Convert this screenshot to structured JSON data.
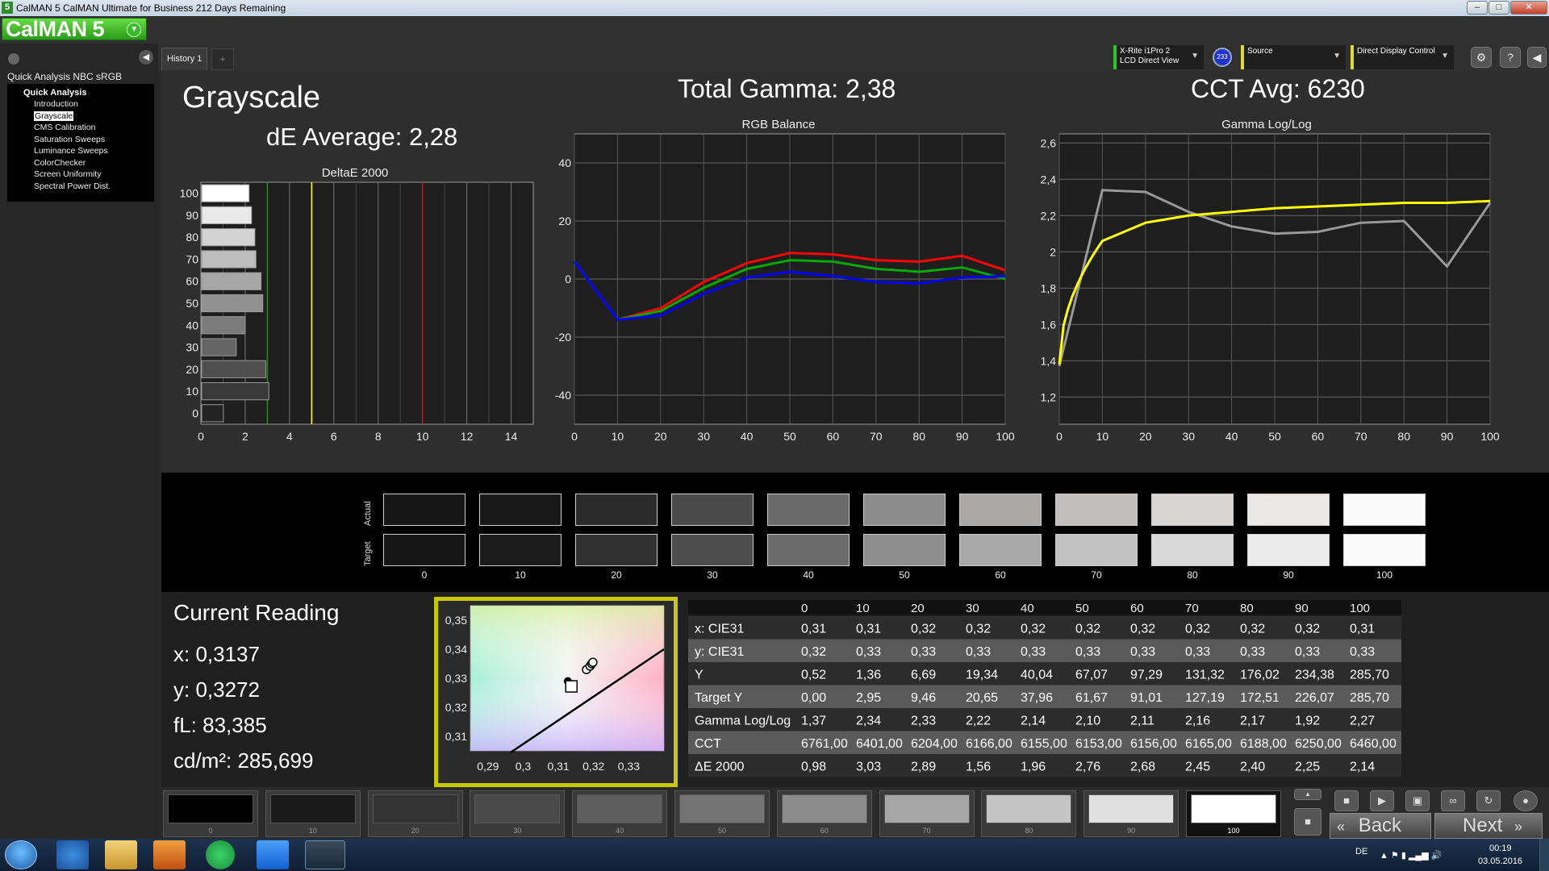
{
  "window": {
    "title": "CalMAN 5 CalMAN Ultimate for Business 212 Days Remaining",
    "app_icon": "5",
    "controls": [
      "–",
      "□",
      "✕"
    ]
  },
  "logo": {
    "text": "CalMAN 5"
  },
  "nav": {
    "title": "Quick Analysis NBC sRGB",
    "group": "Quick Analysis",
    "items": [
      "Introduction",
      "Grayscale",
      "CMS Calibration",
      "Saturation Sweeps",
      "Luminance Sweeps",
      "ColorChecker",
      "Screen Uniformity",
      "Spectral Power Dist."
    ],
    "selected": "Grayscale"
  },
  "tabs": [
    {
      "label": "History 1"
    }
  ],
  "devices": {
    "meter_line1": "X-Rite i1Pro 2",
    "meter_line2": "LCD Direct View",
    "meter_badge": "233",
    "source": "Source",
    "display": "Direct Display Control"
  },
  "toolbar_icons": [
    "gear-icon",
    "help-icon",
    "chevron-left-icon"
  ],
  "headings": {
    "section": "Grayscale",
    "de_average": "dE Average: 2,28",
    "total_gamma": "Total Gamma: 2,38",
    "cct_avg": "CCT Avg: 6230"
  },
  "chart_data": [
    {
      "type": "bar",
      "title": "DeltaE 2000",
      "orientation": "horizontal",
      "categories": [
        "100",
        "90",
        "80",
        "70",
        "60",
        "50",
        "40",
        "30",
        "20",
        "10",
        "0"
      ],
      "values": [
        2.14,
        2.25,
        2.4,
        2.45,
        2.68,
        2.76,
        1.96,
        1.56,
        2.89,
        3.03,
        0.98
      ],
      "xlim": [
        0,
        15
      ],
      "xticks": [
        "0",
        "2",
        "4",
        "6",
        "8",
        "10",
        "12",
        "14"
      ],
      "thresholds": [
        {
          "value": 3,
          "color": "#00aa00"
        },
        {
          "value": 5,
          "color": "#ffff00"
        },
        {
          "value": 10,
          "color": "#ff0000"
        }
      ]
    },
    {
      "type": "line",
      "title": "RGB Balance",
      "x": [
        0,
        10,
        20,
        30,
        40,
        50,
        60,
        70,
        80,
        90,
        100
      ],
      "ylim": [
        -50,
        50
      ],
      "yticks": [
        "40",
        "20",
        "0",
        "-20",
        "-40"
      ],
      "xticks": [
        "0",
        "10",
        "20",
        "30",
        "40",
        "50",
        "60",
        "70",
        "80",
        "90",
        "100"
      ],
      "series": [
        {
          "color": "#ff0000",
          "values": [
            6,
            -14,
            -10,
            -1,
            5.5,
            9,
            8.5,
            6.5,
            6,
            8,
            3
          ]
        },
        {
          "color": "#00aa00",
          "values": [
            6,
            -14,
            -11,
            -3,
            3.5,
            6.5,
            6,
            3.5,
            2.5,
            4,
            0
          ]
        },
        {
          "color": "#0000ff",
          "values": [
            6,
            -14,
            -12.5,
            -5,
            0.5,
            2.5,
            1,
            -1,
            -1.5,
            0.5,
            1
          ]
        }
      ]
    },
    {
      "type": "line",
      "title": "Gamma Log/Log",
      "x": [
        0,
        10,
        20,
        30,
        40,
        50,
        60,
        70,
        80,
        90,
        100
      ],
      "ylim": [
        1.05,
        2.65
      ],
      "yticks": [
        "2,6",
        "2,4",
        "2,2",
        "2",
        "1,8",
        "1,6",
        "1,4",
        "1,2"
      ],
      "xticks": [
        "0",
        "10",
        "20",
        "30",
        "40",
        "50",
        "60",
        "70",
        "80",
        "90",
        "100"
      ],
      "series": [
        {
          "color": "#999999",
          "values": [
            1.37,
            2.34,
            2.33,
            2.22,
            2.14,
            2.1,
            2.11,
            2.16,
            2.17,
            1.92,
            2.27
          ]
        },
        {
          "color": "#ffff00",
          "curve": "target",
          "values": [
            1.38,
            2.06,
            2.16,
            2.2,
            2.22,
            2.24,
            2.25,
            2.26,
            2.27,
            2.27,
            2.28
          ]
        }
      ]
    },
    {
      "type": "scatter",
      "title": "CIE xy",
      "xlim": [
        0.285,
        0.34
      ],
      "ylim": [
        0.305,
        0.355
      ],
      "xticks": [
        "0,29",
        "0,3",
        "0,31",
        "0,32",
        "0,33"
      ],
      "yticks": [
        "0,35",
        "0,34",
        "0,33",
        "0,32",
        "0,31"
      ],
      "target_point": [
        0.3127,
        0.329
      ],
      "measured": [
        [
          0.3137,
          0.3272
        ],
        [
          0.318,
          0.333
        ],
        [
          0.319,
          0.3342
        ],
        [
          0.3195,
          0.335
        ],
        [
          0.3198,
          0.3355
        ]
      ]
    }
  ],
  "swatches": {
    "labels": [
      "0",
      "10",
      "20",
      "30",
      "40",
      "50",
      "60",
      "70",
      "80",
      "90",
      "100"
    ],
    "row_actual": "Actual",
    "row_target": "Target",
    "actual_colors": [
      "#151515",
      "#191919",
      "#2b2b2b",
      "#4a4a4a",
      "#6a6a6a",
      "#8c8c8c",
      "#a9a8a7",
      "#c0bfbd",
      "#d7d6d4",
      "#eae9e7",
      "#fbfbfb"
    ],
    "target_colors": [
      "#151515",
      "#1b1b1b",
      "#303030",
      "#4d4d4d",
      "#6b6b6b",
      "#8e8e8e",
      "#a9a9a9",
      "#c2c2c2",
      "#d9d9d9",
      "#ececec",
      "#fbfbfb"
    ]
  },
  "current_reading": {
    "title": "Current Reading",
    "x": "x: 0,3137",
    "y": "y: 0,3272",
    "fl": "fL: 83,385",
    "cdm": "cd/m²: 285,699"
  },
  "table": {
    "headers": [
      "",
      "0",
      "10",
      "20",
      "30",
      "40",
      "50",
      "60",
      "70",
      "80",
      "90",
      "100"
    ],
    "rows": [
      [
        "x: CIE31",
        "0,31",
        "0,31",
        "0,32",
        "0,32",
        "0,32",
        "0,32",
        "0,32",
        "0,32",
        "0,32",
        "0,32",
        "0,31"
      ],
      [
        "y: CIE31",
        "0,32",
        "0,33",
        "0,33",
        "0,33",
        "0,33",
        "0,33",
        "0,33",
        "0,33",
        "0,33",
        "0,33",
        "0,33"
      ],
      [
        "Y",
        "0,52",
        "1,36",
        "6,69",
        "19,34",
        "40,04",
        "67,07",
        "97,29",
        "131,32",
        "176,02",
        "234,38",
        "285,70"
      ],
      [
        "Target Y",
        "0,00",
        "2,95",
        "9,46",
        "20,65",
        "37,96",
        "61,67",
        "91,01",
        "127,19",
        "172,51",
        "226,07",
        "285,70"
      ],
      [
        "Gamma Log/Log",
        "1,37",
        "2,34",
        "2,33",
        "2,22",
        "2,14",
        "2,10",
        "2,11",
        "2,16",
        "2,17",
        "1,92",
        "2,27"
      ],
      [
        "CCT",
        "6761,00",
        "6401,00",
        "6204,00",
        "6166,00",
        "6155,00",
        "6153,00",
        "6156,00",
        "6165,00",
        "6188,00",
        "6250,00",
        "6460,00"
      ],
      [
        "ΔE 2000",
        "0,98",
        "3,03",
        "2,89",
        "1,56",
        "1,96",
        "2,76",
        "2,68",
        "2,45",
        "2,40",
        "2,25",
        "2,14"
      ]
    ]
  },
  "patch_selector": {
    "labels": [
      "0",
      "10",
      "20",
      "30",
      "40",
      "50",
      "60",
      "70",
      "80",
      "90",
      "100"
    ],
    "colors": [
      "#000000",
      "#1a1a1a",
      "#333333",
      "#4a4a4a",
      "#5e5e5e",
      "#737373",
      "#8c8c8c",
      "#a6a6a6",
      "#c4c4c4",
      "#e0e0e0",
      "#ffffff"
    ],
    "selected": "100"
  },
  "navigation": {
    "back": "Back",
    "next": "Next"
  },
  "taskbar": {
    "lang": "DE",
    "time": "00:19",
    "date": "03.05.2016"
  }
}
